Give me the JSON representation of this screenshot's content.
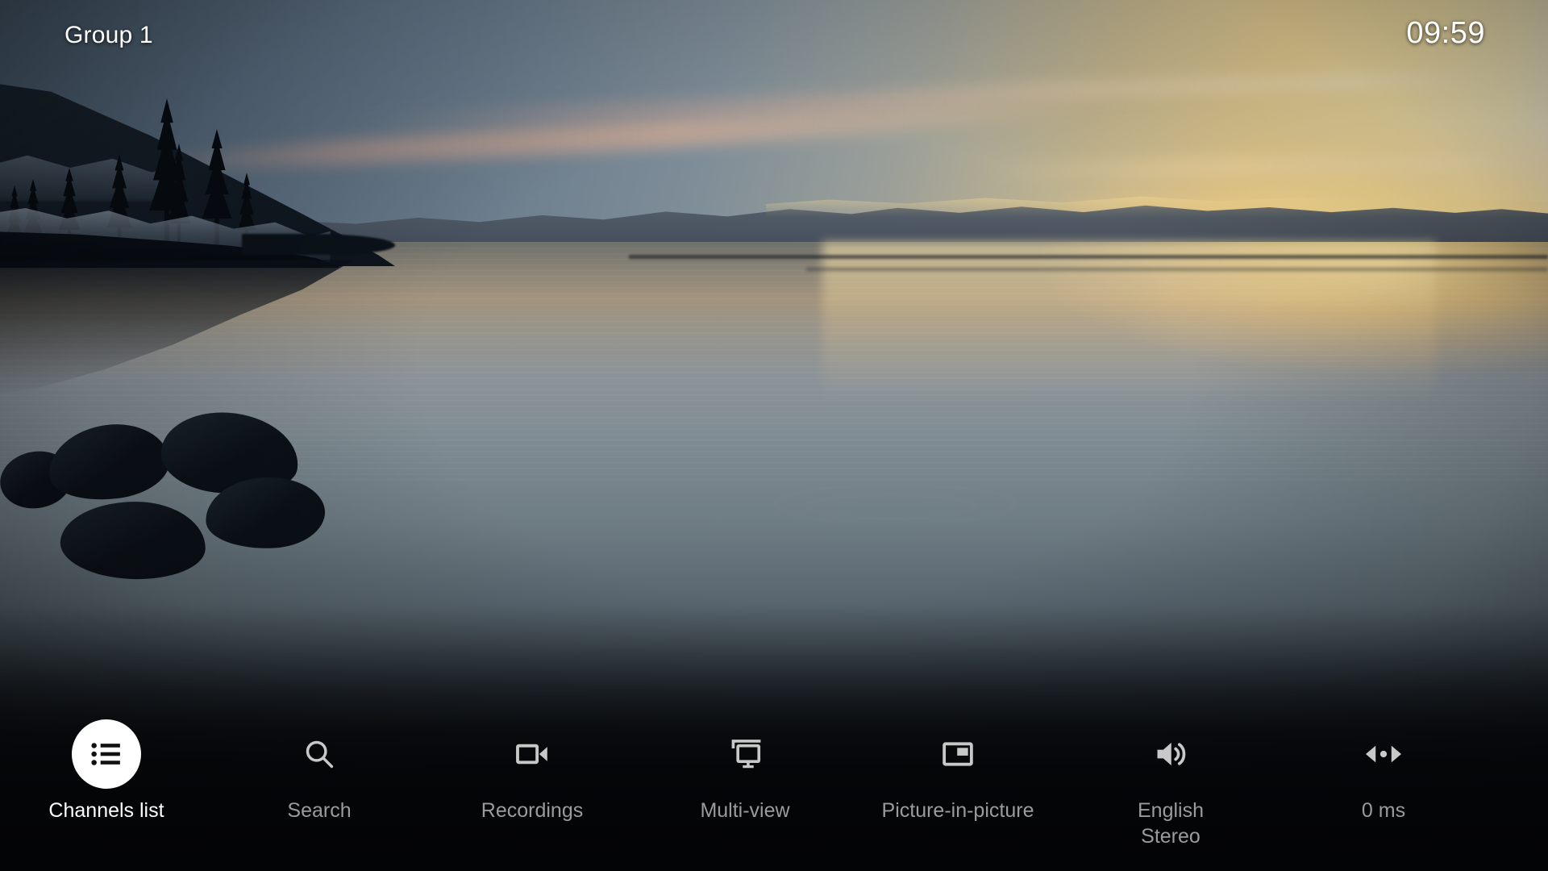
{
  "top_bar": {
    "group_label": "Group 1",
    "clock": "09:59"
  },
  "video": {
    "description": "Lake sunset with silhouetted pine trees, snowy rocky shore on the left, dark boulders in the foreground water, distant mountain ridge and golden glow reflected on the calm water to the right",
    "colors": {
      "sky_blue": "#56697c",
      "sky_gold": "#fdf6dc",
      "glow": "#ffe296",
      "water_mid": "#7e8b92",
      "water_dark": "#05070a",
      "silhouette": "#070c12"
    }
  },
  "toolbar": {
    "selected_index": 0,
    "accent_selected_bg": "#ffffff",
    "label_color": "#9b9b9b",
    "label_color_selected": "#ffffff",
    "items": [
      {
        "label": "Channels list",
        "icon": "list-icon",
        "selected": true
      },
      {
        "label": "Search",
        "icon": "search-icon",
        "selected": false
      },
      {
        "label": "Recordings",
        "icon": "video-camera-icon",
        "selected": false
      },
      {
        "label": "Multi-view",
        "icon": "multi-screen-icon",
        "selected": false
      },
      {
        "label": "Picture-in-picture",
        "icon": "picture-in-picture-icon",
        "selected": false
      },
      {
        "label": "English\nStereo",
        "icon": "speaker-icon",
        "selected": false
      },
      {
        "label": "0 ms",
        "icon": "audio-sync-icon",
        "selected": false
      }
    ]
  }
}
